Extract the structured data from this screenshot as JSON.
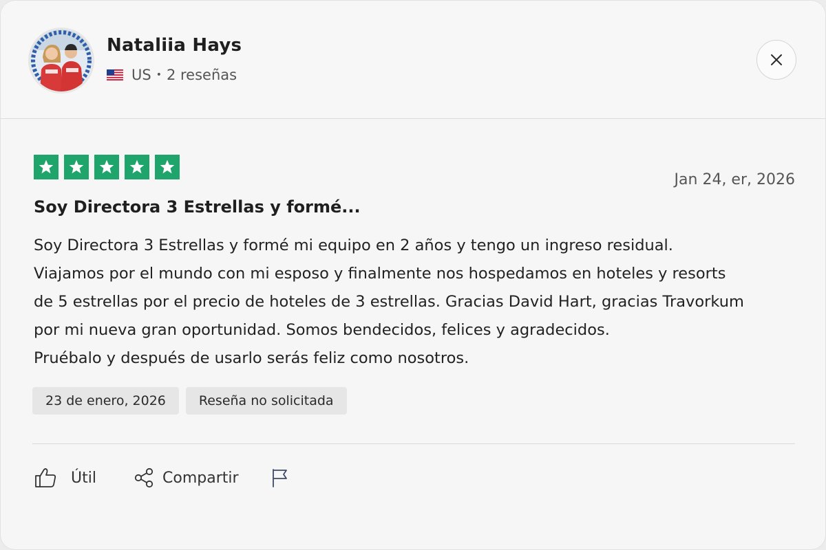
{
  "reviewer": {
    "name": "Nataliia Hays",
    "country": "US",
    "separator": "•",
    "reviews_count": "2 reseñas",
    "avatar_icon": "reviewer-photo"
  },
  "header": {
    "close_icon": "close-icon"
  },
  "review": {
    "rating": 5,
    "rating_max": 5,
    "star_color": "#1fa56b",
    "date_top": "Jan 24, er, 2026",
    "title": "Soy Directora 3 Estrellas y formé...",
    "body_lines": [
      "Soy Directora 3 Estrellas y formé mi equipo en 2 años y tengo un ingreso residual.",
      "Viajamos por el mundo con mi esposo y finalmente nos hospedamos en hoteles y resorts",
      "de 5 estrellas por el precio de hoteles de 3 estrellas. Gracias David Hart, gracias Travorkum",
      "por mi nueva gran oportunidad. Somos bendecidos, felices y agradecidos.",
      "Pruébalo y después de usarlo serás feliz como nosotros."
    ],
    "experience_date": "23 de enero, 2026",
    "tag": "Reseña no solicitada"
  },
  "actions": {
    "useful_label": "Útil",
    "useful_icon": "thumbs-up-icon",
    "share_label": "Compartir",
    "share_icon": "share-icon",
    "flag_icon": "flag-icon"
  }
}
